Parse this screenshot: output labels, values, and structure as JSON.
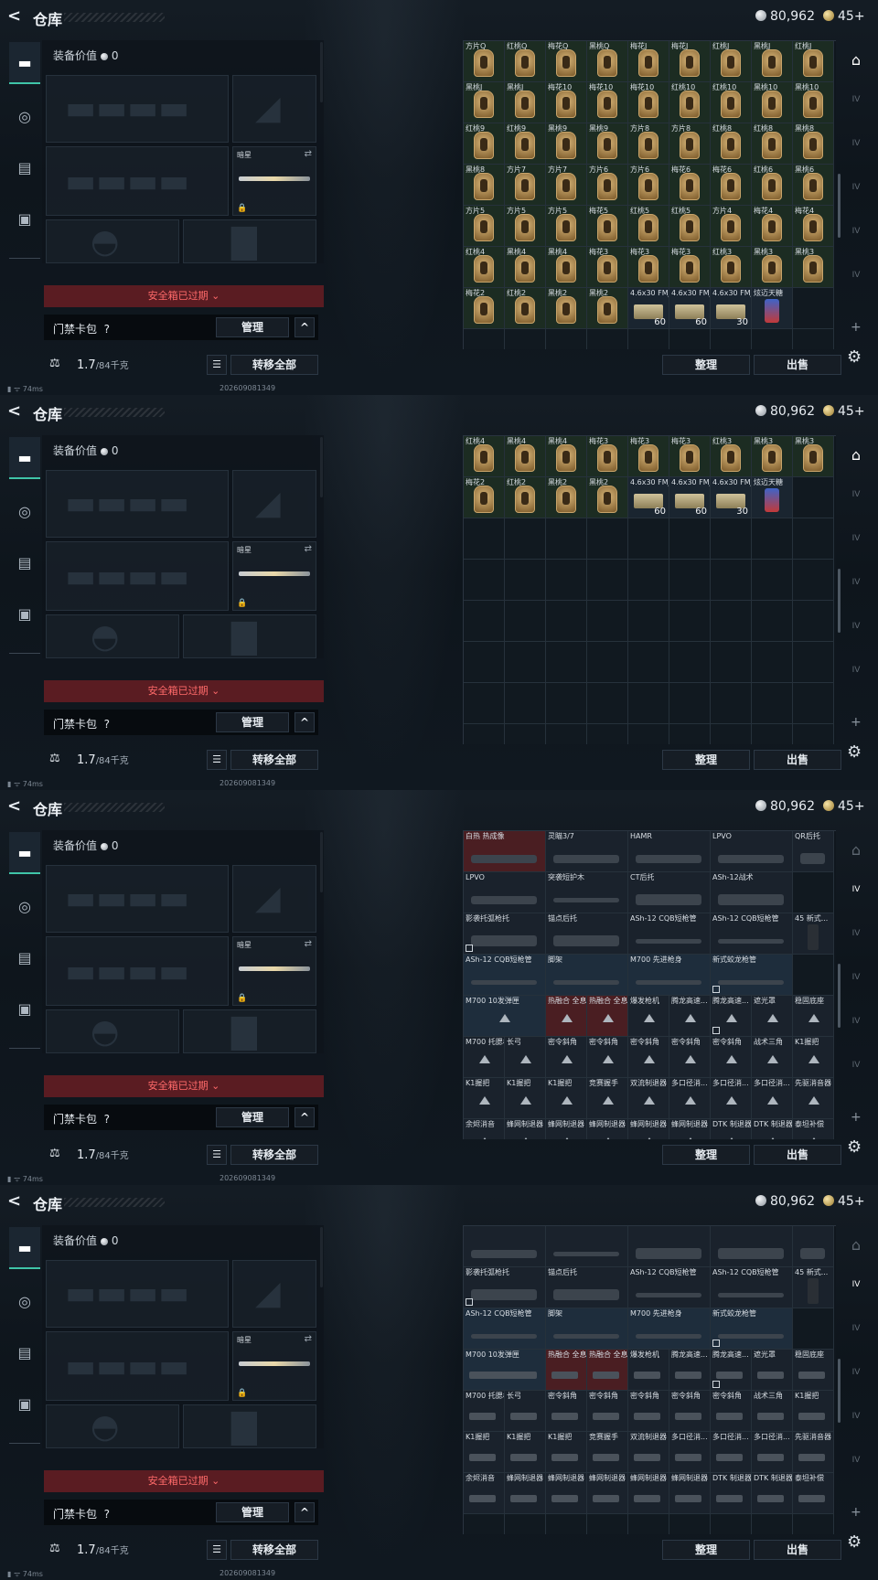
{
  "app": {
    "title": "仓库",
    "back": "<"
  },
  "currency": {
    "silver": "80,962",
    "gold": "45+"
  },
  "equip": {
    "value_label": "装备价值",
    "value": "0",
    "sub_label": "暗星",
    "safe_box_expired": "安全箱已过期 ⌄",
    "keycard_label": "门禁卡包",
    "help": "?",
    "manage": "管理",
    "collapse": "^",
    "weight": "1.7",
    "weight_max": "/84千克",
    "transfer_all": "转移全部"
  },
  "actions": {
    "sort": "整理",
    "sell": "出售"
  },
  "status": {
    "ping": "74ms",
    "version": "202609081349"
  },
  "right_tabs": [
    "IV",
    "IV",
    "IV",
    "IV",
    "IV",
    "IV"
  ],
  "frames": [
    {
      "cols": 9,
      "cells": [
        {
          "n": "方片Q",
          "t": "card"
        },
        {
          "n": "红桃Q",
          "t": "card"
        },
        {
          "n": "梅花Q",
          "t": "card"
        },
        {
          "n": "黑桃Q",
          "t": "card"
        },
        {
          "n": "梅花J",
          "t": "card"
        },
        {
          "n": "梅花J",
          "t": "card"
        },
        {
          "n": "红桃J",
          "t": "card"
        },
        {
          "n": "黑桃J",
          "t": "card"
        },
        {
          "n": "红桃J",
          "t": "card"
        },
        {
          "n": "黑桃J",
          "t": "card"
        },
        {
          "n": "黑桃J",
          "t": "card"
        },
        {
          "n": "梅花10",
          "t": "card"
        },
        {
          "n": "梅花10",
          "t": "card"
        },
        {
          "n": "梅花10",
          "t": "card"
        },
        {
          "n": "红桃10",
          "t": "card"
        },
        {
          "n": "红桃10",
          "t": "card"
        },
        {
          "n": "黑桃10",
          "t": "card"
        },
        {
          "n": "黑桃10",
          "t": "card"
        },
        {
          "n": "红桃9",
          "t": "card"
        },
        {
          "n": "红桃9",
          "t": "card"
        },
        {
          "n": "黑桃9",
          "t": "card"
        },
        {
          "n": "黑桃9",
          "t": "card"
        },
        {
          "n": "方片8",
          "t": "card"
        },
        {
          "n": "方片8",
          "t": "card"
        },
        {
          "n": "红桃8",
          "t": "card"
        },
        {
          "n": "红桃8",
          "t": "card"
        },
        {
          "n": "黑桃8",
          "t": "card"
        },
        {
          "n": "黑桃8",
          "t": "card"
        },
        {
          "n": "方片7",
          "t": "card"
        },
        {
          "n": "方片7",
          "t": "card"
        },
        {
          "n": "方片6",
          "t": "card"
        },
        {
          "n": "方片6",
          "t": "card"
        },
        {
          "n": "梅花6",
          "t": "card"
        },
        {
          "n": "梅花6",
          "t": "card"
        },
        {
          "n": "红桃6",
          "t": "card"
        },
        {
          "n": "黑桃6",
          "t": "card"
        },
        {
          "n": "方片5",
          "t": "card"
        },
        {
          "n": "方片5",
          "t": "card"
        },
        {
          "n": "方片5",
          "t": "card"
        },
        {
          "n": "梅花5",
          "t": "card"
        },
        {
          "n": "红桃5",
          "t": "card"
        },
        {
          "n": "红桃5",
          "t": "card"
        },
        {
          "n": "方片4",
          "t": "card"
        },
        {
          "n": "梅花4",
          "t": "card"
        },
        {
          "n": "梅花4",
          "t": "card"
        },
        {
          "n": "红桃4",
          "t": "card"
        },
        {
          "n": "黑桃4",
          "t": "card"
        },
        {
          "n": "黑桃4",
          "t": "card"
        },
        {
          "n": "梅花3",
          "t": "card"
        },
        {
          "n": "梅花3",
          "t": "card"
        },
        {
          "n": "梅花3",
          "t": "card"
        },
        {
          "n": "红桃3",
          "t": "card"
        },
        {
          "n": "黑桃3",
          "t": "card"
        },
        {
          "n": "黑桃3",
          "t": "card"
        },
        {
          "n": "梅花2",
          "t": "card"
        },
        {
          "n": "红桃2",
          "t": "card"
        },
        {
          "n": "黑桃2",
          "t": "card"
        },
        {
          "n": "黑桃2",
          "t": "card"
        },
        {
          "n": "4.6x30 FMJ",
          "t": "ammo",
          "q": "60"
        },
        {
          "n": "4.6x30 FMJ",
          "t": "ammo",
          "q": "60"
        },
        {
          "n": "4.6x30 FMJ",
          "t": "ammo",
          "q": "30"
        },
        {
          "n": "炫迈天糖",
          "t": "can"
        },
        {
          "n": "",
          "t": "empty"
        }
      ]
    },
    {
      "cols": 9,
      "cells": [
        {
          "n": "红桃4",
          "t": "card"
        },
        {
          "n": "黑桃4",
          "t": "card"
        },
        {
          "n": "黑桃4",
          "t": "card"
        },
        {
          "n": "梅花3",
          "t": "card"
        },
        {
          "n": "梅花3",
          "t": "card"
        },
        {
          "n": "梅花3",
          "t": "card"
        },
        {
          "n": "红桃3",
          "t": "card"
        },
        {
          "n": "黑桃3",
          "t": "card"
        },
        {
          "n": "黑桃3",
          "t": "card"
        },
        {
          "n": "梅花2",
          "t": "card"
        },
        {
          "n": "红桃2",
          "t": "card"
        },
        {
          "n": "黑桃2",
          "t": "card"
        },
        {
          "n": "黑桃2",
          "t": "card"
        },
        {
          "n": "4.6x30 FMJ",
          "t": "ammo",
          "q": "60"
        },
        {
          "n": "4.6x30 FMJ",
          "t": "ammo",
          "q": "60"
        },
        {
          "n": "4.6x30 FMJ",
          "t": "ammo",
          "q": "30"
        },
        {
          "n": "炫迈天糖",
          "t": "can"
        },
        {
          "n": "",
          "t": "empty"
        }
      ]
    },
    {
      "cols": 9,
      "cells": [
        {
          "n": "白热 热成像",
          "t": "scope",
          "w": 2,
          "bg": "red"
        },
        {
          "n": "灵瞄3/7",
          "t": "scope",
          "w": 2
        },
        {
          "n": "HAMR",
          "t": "scope",
          "w": 2
        },
        {
          "n": "LPVO",
          "t": "scope",
          "w": 2
        },
        {
          "n": "QR后托",
          "t": "stock"
        },
        {
          "n": "LPVO",
          "t": "scope",
          "w": 2
        },
        {
          "n": "突袭短护木",
          "t": "rail",
          "w": 2
        },
        {
          "n": "CT后托",
          "t": "stock",
          "w": 2
        },
        {
          "n": "ASh-12战术",
          "t": "stock",
          "w": 2
        },
        {
          "n": "",
          "t": "empty"
        },
        {
          "n": "影袭托弧枪托",
          "t": "stock",
          "w": 2,
          "b": true
        },
        {
          "n": "锚点后托",
          "t": "stock",
          "w": 2
        },
        {
          "n": "ASh-12 CQB短枪管",
          "t": "barrel",
          "w": 2
        },
        {
          "n": "ASh-12 CQB短枪管",
          "t": "barrel",
          "w": 2
        },
        {
          "n": "45 新式...",
          "t": "mag"
        },
        {
          "n": "ASh-12 CQB短枪管",
          "t": "barrel",
          "w": 2,
          "bg": "blue"
        },
        {
          "n": "脚架",
          "t": "bipod",
          "w": 2,
          "bg": "blue"
        },
        {
          "n": "M700 先进枪身",
          "t": "barrel",
          "w": 2,
          "bg": "blue"
        },
        {
          "n": "新式蛟龙枪管",
          "t": "barrel",
          "w": 2,
          "bg": "blue",
          "b": true
        },
        {
          "n": "",
          "t": "empty"
        },
        {
          "n": "M700 10发弹匣",
          "t": "tri",
          "w": 2,
          "bg": "blue"
        },
        {
          "n": "热融合 全息",
          "t": "tri",
          "bg": "red"
        },
        {
          "n": "热融合 全息",
          "t": "tri",
          "bg": "red"
        },
        {
          "n": "爆发枪机",
          "t": "tri"
        },
        {
          "n": "腾龙高速...",
          "t": "tri"
        },
        {
          "n": "腾龙高速...",
          "t": "tri",
          "b": true
        },
        {
          "n": "遮光罩",
          "t": "tri"
        },
        {
          "n": "稳固底座",
          "t": "tri"
        },
        {
          "n": "M700 托腮板",
          "t": "tri"
        },
        {
          "n": "长弓",
          "t": "tri"
        },
        {
          "n": "密令斜角",
          "t": "tri"
        },
        {
          "n": "密令斜角",
          "t": "tri"
        },
        {
          "n": "密令斜角",
          "t": "tri"
        },
        {
          "n": "密令斜角",
          "t": "tri"
        },
        {
          "n": "密令斜角",
          "t": "tri"
        },
        {
          "n": "战术三角",
          "t": "tri"
        },
        {
          "n": "K1握把",
          "t": "tri"
        },
        {
          "n": "K1握把",
          "t": "tri"
        },
        {
          "n": "K1握把",
          "t": "tri"
        },
        {
          "n": "K1握把",
          "t": "tri"
        },
        {
          "n": "竞赛握手",
          "t": "tri"
        },
        {
          "n": "双流制退器",
          "t": "tri"
        },
        {
          "n": "多口径消...",
          "t": "tri"
        },
        {
          "n": "多口径消...",
          "t": "tri"
        },
        {
          "n": "多口径消...",
          "t": "tri"
        },
        {
          "n": "先驱消音器",
          "t": "tri"
        },
        {
          "n": "余烬消音",
          "t": "tri"
        },
        {
          "n": "蜂网制退器",
          "t": "tri"
        },
        {
          "n": "蜂网制退器",
          "t": "tri"
        },
        {
          "n": "蜂网制退器",
          "t": "tri"
        },
        {
          "n": "蜂网制退器",
          "t": "tri"
        },
        {
          "n": "蜂网制退器",
          "t": "tri"
        },
        {
          "n": "DTK 制退器",
          "t": "tri"
        },
        {
          "n": "DTK 制退器",
          "t": "tri"
        },
        {
          "n": "泰坦补偿",
          "t": "tri"
        }
      ]
    },
    {
      "cols": 9,
      "cells": [
        {
          "n": "",
          "t": "scope",
          "w": 2
        },
        {
          "n": "",
          "t": "rail",
          "w": 2
        },
        {
          "n": "",
          "t": "stock",
          "w": 2
        },
        {
          "n": "",
          "t": "stock",
          "w": 2
        },
        {
          "n": "",
          "t": "stock"
        },
        {
          "n": "影袭托弧枪托",
          "t": "stock",
          "w": 2,
          "b": true
        },
        {
          "n": "锚点后托",
          "t": "stock",
          "w": 2
        },
        {
          "n": "ASh-12 CQB短枪管",
          "t": "barrel",
          "w": 2
        },
        {
          "n": "ASh-12 CQB短枪管",
          "t": "barrel",
          "w": 2
        },
        {
          "n": "45 新式...",
          "t": "mag"
        },
        {
          "n": "ASh-12 CQB短枪管",
          "t": "barrel",
          "w": 2,
          "bg": "blue"
        },
        {
          "n": "脚架",
          "t": "bipod",
          "w": 2,
          "bg": "blue"
        },
        {
          "n": "M700 先进枪身",
          "t": "barrel",
          "w": 2,
          "bg": "blue"
        },
        {
          "n": "新式蛟龙枪管",
          "t": "barrel",
          "w": 2,
          "bg": "blue",
          "b": true
        },
        {
          "n": "",
          "t": "empty"
        },
        {
          "n": "M700 10发弹匣",
          "t": "mod",
          "w": 2,
          "bg": "blue"
        },
        {
          "n": "热融合 全息",
          "t": "mod",
          "bg": "red"
        },
        {
          "n": "热融合 全息",
          "t": "mod",
          "bg": "red"
        },
        {
          "n": "爆发枪机",
          "t": "mod"
        },
        {
          "n": "腾龙高速...",
          "t": "mod"
        },
        {
          "n": "腾龙高速...",
          "t": "mod",
          "b": true
        },
        {
          "n": "遮光罩",
          "t": "mod"
        },
        {
          "n": "稳固底座",
          "t": "mod"
        },
        {
          "n": "M700 托腮板",
          "t": "mod"
        },
        {
          "n": "长弓",
          "t": "mod"
        },
        {
          "n": "密令斜角",
          "t": "mod"
        },
        {
          "n": "密令斜角",
          "t": "mod"
        },
        {
          "n": "密令斜角",
          "t": "mod"
        },
        {
          "n": "密令斜角",
          "t": "mod"
        },
        {
          "n": "密令斜角",
          "t": "mod"
        },
        {
          "n": "战术三角",
          "t": "mod"
        },
        {
          "n": "K1握把",
          "t": "mod"
        },
        {
          "n": "K1握把",
          "t": "mod"
        },
        {
          "n": "K1握把",
          "t": "mod"
        },
        {
          "n": "K1握把",
          "t": "mod"
        },
        {
          "n": "竞赛握手",
          "t": "mod"
        },
        {
          "n": "双流制退器",
          "t": "mod"
        },
        {
          "n": "多口径消...",
          "t": "mod"
        },
        {
          "n": "多口径消...",
          "t": "mod"
        },
        {
          "n": "多口径消...",
          "t": "mod"
        },
        {
          "n": "先驱消音器",
          "t": "mod"
        },
        {
          "n": "余烬消音",
          "t": "mod"
        },
        {
          "n": "蜂网制退器",
          "t": "mod"
        },
        {
          "n": "蜂网制退器",
          "t": "mod"
        },
        {
          "n": "蜂网制退器",
          "t": "mod"
        },
        {
          "n": "蜂网制退器",
          "t": "mod"
        },
        {
          "n": "蜂网制退器",
          "t": "mod"
        },
        {
          "n": "DTK 制退器",
          "t": "mod"
        },
        {
          "n": "DTK 制退器",
          "t": "mod"
        },
        {
          "n": "泰坦补偿",
          "t": "mod"
        }
      ]
    }
  ]
}
